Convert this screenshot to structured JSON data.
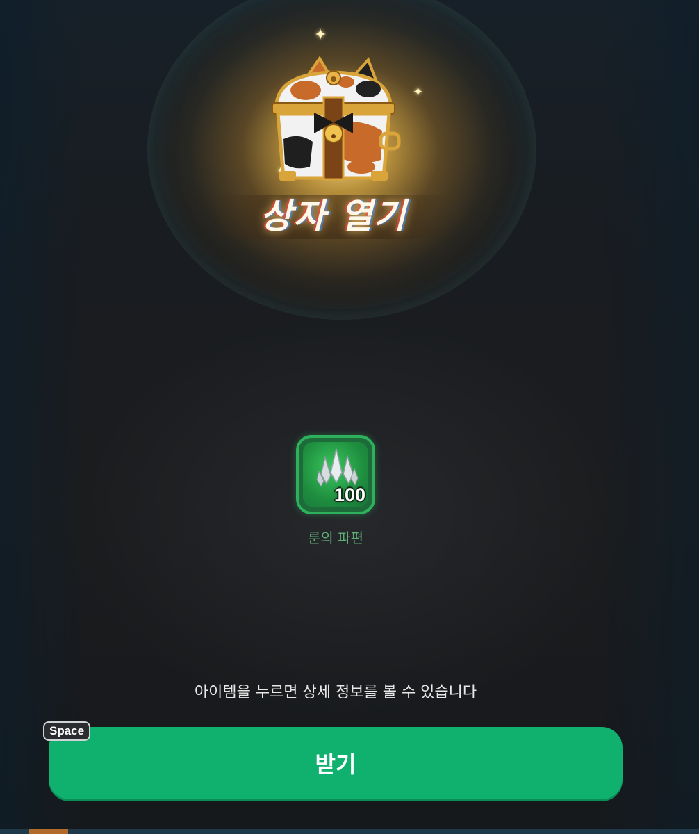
{
  "reward_popup": {
    "title": "상자 열기",
    "chest_icon": "calico-cat-treasure-chest-icon",
    "items": [
      {
        "name": "룬의 파편",
        "count": "100",
        "icon": "rune-shard-crystals-icon",
        "frame_color": "#2fb05c"
      }
    ],
    "hint": "아이템을 누르면 상세 정보를 볼 수 있습니다",
    "receive_button": {
      "label": "받기",
      "key_hint": "Space",
      "color": "#10b06e"
    }
  }
}
